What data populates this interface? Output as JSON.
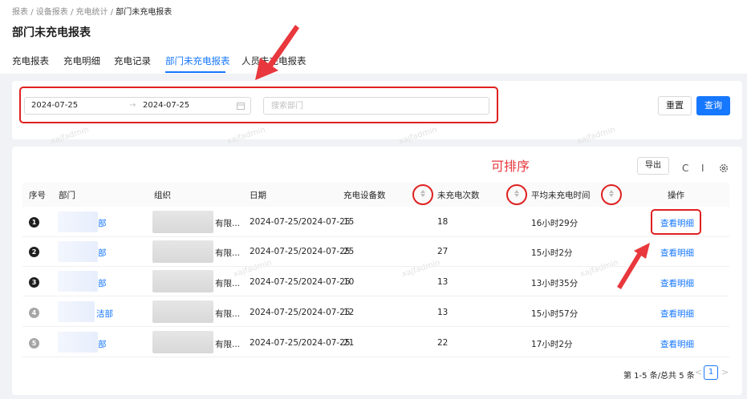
{
  "breadcrumb": {
    "items": [
      "报表",
      "设备报表",
      "充电统计"
    ],
    "current": "部门未充电报表",
    "sep": "/"
  },
  "page_title": "部门未充电报表",
  "tabs": [
    {
      "label": "充电报表"
    },
    {
      "label": "充电明细"
    },
    {
      "label": "充电记录"
    },
    {
      "label": "部门未充电报表"
    },
    {
      "label": "人员未充电报表"
    }
  ],
  "filter": {
    "start_date": "2024-07-25",
    "arrow": "→",
    "end_date": "2024-07-25",
    "calendar_icon": "calendar-icon",
    "dept_placeholder": "搜索部门",
    "reset_label": "重置",
    "query_label": "查询"
  },
  "watermark": "xajfadmin",
  "annotation": {
    "sortable_note": "可排序"
  },
  "toolbar": {
    "export_label": "导出",
    "refresh_icon": "C",
    "density_icon": "I",
    "settings_icon": "gear-icon"
  },
  "table": {
    "columns": [
      "序号",
      "部门",
      "组织",
      "日期",
      "充电设备数",
      "未充电次数",
      "平均未充电时间",
      "操作"
    ],
    "rows": [
      {
        "index": "1",
        "dept": "部",
        "org": "有限...",
        "date": "2024-07-25/2024-07-25",
        "devices": "15",
        "uncharged": "18",
        "avg_time": "16小时29分",
        "action": "查看明细"
      },
      {
        "index": "2",
        "dept": "部",
        "org": "有限...",
        "date": "2024-07-25/2024-07-25",
        "devices": "25",
        "uncharged": "27",
        "avg_time": "15小时2分",
        "action": "查看明细"
      },
      {
        "index": "3",
        "dept": "部",
        "org": "有限...",
        "date": "2024-07-25/2024-07-25",
        "devices": "10",
        "uncharged": "13",
        "avg_time": "13小时35分",
        "action": "查看明细"
      },
      {
        "index": "4",
        "dept": "洁部",
        "org": "有限...",
        "date": "2024-07-25/2024-07-25",
        "devices": "12",
        "uncharged": "13",
        "avg_time": "15小时57分",
        "action": "查看明细"
      },
      {
        "index": "5",
        "dept": "部",
        "org": "有限...",
        "date": "2024-07-25/2024-07-25",
        "devices": "21",
        "uncharged": "22",
        "avg_time": "17小时2分",
        "action": "查看明细"
      }
    ]
  },
  "pagination": {
    "summary": "第 1-5 条/总共 5 条",
    "current_page": "1",
    "prev": "<",
    "next": ">"
  },
  "colors": {
    "primary": "#1677ff",
    "annotation_red": "#e02020"
  }
}
